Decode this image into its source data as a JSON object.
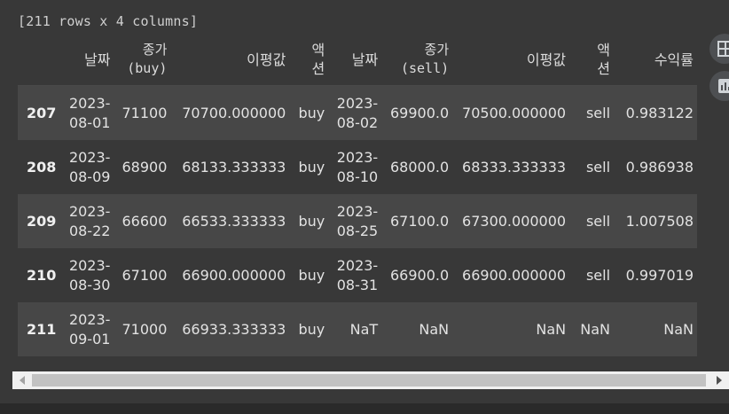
{
  "meta": {
    "shape_text": "[211 rows x 4 columns]"
  },
  "table": {
    "headers": [
      {
        "label": "",
        "mono": false
      },
      {
        "label": "날짜",
        "mono": false
      },
      {
        "label": "종가\n(buy)",
        "mono": true
      },
      {
        "label": "이평값",
        "mono": false
      },
      {
        "label": "액\n션",
        "mono": false
      },
      {
        "label": "날짜",
        "mono": false
      },
      {
        "label": "종가\n(sell)",
        "mono": true
      },
      {
        "label": "이평값",
        "mono": false
      },
      {
        "label": "액\n션",
        "mono": false
      },
      {
        "label": "수익률",
        "mono": false
      }
    ],
    "rows": [
      {
        "index": "207",
        "cells": [
          "2023-\n08-01",
          "71100",
          "70700.000000",
          "buy",
          "2023-\n08-02",
          "69900.0",
          "70500.000000",
          "sell",
          "0.983122"
        ]
      },
      {
        "index": "208",
        "cells": [
          "2023-\n08-09",
          "68900",
          "68133.333333",
          "buy",
          "2023-\n08-10",
          "68000.0",
          "68333.333333",
          "sell",
          "0.986938"
        ]
      },
      {
        "index": "209",
        "cells": [
          "2023-\n08-22",
          "66600",
          "66533.333333",
          "buy",
          "2023-\n08-25",
          "67100.0",
          "67300.000000",
          "sell",
          "1.007508"
        ]
      },
      {
        "index": "210",
        "cells": [
          "2023-\n08-30",
          "67100",
          "66900.000000",
          "buy",
          "2023-\n08-31",
          "66900.0",
          "66900.000000",
          "sell",
          "0.997019"
        ]
      },
      {
        "index": "211",
        "cells": [
          "2023-\n09-01",
          "71000",
          "66933.333333",
          "buy",
          "NaT",
          "NaN",
          "NaN",
          "NaN",
          "NaN"
        ]
      }
    ]
  },
  "toolbar": {
    "buttons": [
      {
        "icon": "table-icon"
      },
      {
        "icon": "chart-icon"
      }
    ]
  },
  "colors": {
    "background": "#383838",
    "row_stripe": "#474747",
    "text": "#e2e2e2",
    "scrollbar_track": "#f0f0f0",
    "scrollbar_thumb": "#c2c2c2"
  }
}
